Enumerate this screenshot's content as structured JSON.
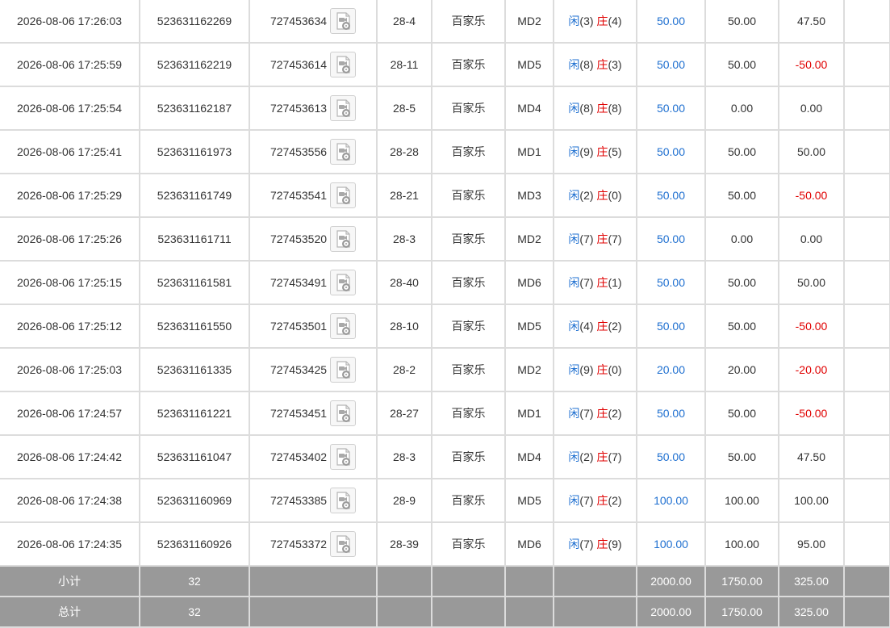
{
  "colors": {
    "player": "#1e6fd0",
    "banker": "#e00000",
    "negative": "#e00000",
    "summary_bg": "#999999"
  },
  "icons": {
    "replay": "video-replay-icon"
  },
  "rows": [
    {
      "time": "2026-08-06 17:26:03",
      "bet_id": "523631162269",
      "round_id": "727453634",
      "shoe": "28-4",
      "game": "百家乐",
      "table": "MD2",
      "player_label": "闲",
      "player_score": "(3)",
      "banker_label": "庄",
      "banker_score": "(4)",
      "bet": "50.00",
      "valid": "50.00",
      "payout": "47.50",
      "payout_negative": false
    },
    {
      "time": "2026-08-06 17:25:59",
      "bet_id": "523631162219",
      "round_id": "727453614",
      "shoe": "28-11",
      "game": "百家乐",
      "table": "MD5",
      "player_label": "闲",
      "player_score": "(8)",
      "banker_label": "庄",
      "banker_score": "(3)",
      "bet": "50.00",
      "valid": "50.00",
      "payout": "-50.00",
      "payout_negative": true
    },
    {
      "time": "2026-08-06 17:25:54",
      "bet_id": "523631162187",
      "round_id": "727453613",
      "shoe": "28-5",
      "game": "百家乐",
      "table": "MD4",
      "player_label": "闲",
      "player_score": "(8)",
      "banker_label": "庄",
      "banker_score": "(8)",
      "bet": "50.00",
      "valid": "0.00",
      "payout": "0.00",
      "payout_negative": false
    },
    {
      "time": "2026-08-06 17:25:41",
      "bet_id": "523631161973",
      "round_id": "727453556",
      "shoe": "28-28",
      "game": "百家乐",
      "table": "MD1",
      "player_label": "闲",
      "player_score": "(9)",
      "banker_label": "庄",
      "banker_score": "(5)",
      "bet": "50.00",
      "valid": "50.00",
      "payout": "50.00",
      "payout_negative": false
    },
    {
      "time": "2026-08-06 17:25:29",
      "bet_id": "523631161749",
      "round_id": "727453541",
      "shoe": "28-21",
      "game": "百家乐",
      "table": "MD3",
      "player_label": "闲",
      "player_score": "(2)",
      "banker_label": "庄",
      "banker_score": "(0)",
      "bet": "50.00",
      "valid": "50.00",
      "payout": "-50.00",
      "payout_negative": true
    },
    {
      "time": "2026-08-06 17:25:26",
      "bet_id": "523631161711",
      "round_id": "727453520",
      "shoe": "28-3",
      "game": "百家乐",
      "table": "MD2",
      "player_label": "闲",
      "player_score": "(7)",
      "banker_label": "庄",
      "banker_score": "(7)",
      "bet": "50.00",
      "valid": "0.00",
      "payout": "0.00",
      "payout_negative": false
    },
    {
      "time": "2026-08-06 17:25:15",
      "bet_id": "523631161581",
      "round_id": "727453491",
      "shoe": "28-40",
      "game": "百家乐",
      "table": "MD6",
      "player_label": "闲",
      "player_score": "(7)",
      "banker_label": "庄",
      "banker_score": "(1)",
      "bet": "50.00",
      "valid": "50.00",
      "payout": "50.00",
      "payout_negative": false
    },
    {
      "time": "2026-08-06 17:25:12",
      "bet_id": "523631161550",
      "round_id": "727453501",
      "shoe": "28-10",
      "game": "百家乐",
      "table": "MD5",
      "player_label": "闲",
      "player_score": "(4)",
      "banker_label": "庄",
      "banker_score": "(2)",
      "bet": "50.00",
      "valid": "50.00",
      "payout": "-50.00",
      "payout_negative": true
    },
    {
      "time": "2026-08-06 17:25:03",
      "bet_id": "523631161335",
      "round_id": "727453425",
      "shoe": "28-2",
      "game": "百家乐",
      "table": "MD2",
      "player_label": "闲",
      "player_score": "(9)",
      "banker_label": "庄",
      "banker_score": "(0)",
      "bet": "20.00",
      "valid": "20.00",
      "payout": "-20.00",
      "payout_negative": true
    },
    {
      "time": "2026-08-06 17:24:57",
      "bet_id": "523631161221",
      "round_id": "727453451",
      "shoe": "28-27",
      "game": "百家乐",
      "table": "MD1",
      "player_label": "闲",
      "player_score": "(7)",
      "banker_label": "庄",
      "banker_score": "(2)",
      "bet": "50.00",
      "valid": "50.00",
      "payout": "-50.00",
      "payout_negative": true
    },
    {
      "time": "2026-08-06 17:24:42",
      "bet_id": "523631161047",
      "round_id": "727453402",
      "shoe": "28-3",
      "game": "百家乐",
      "table": "MD4",
      "player_label": "闲",
      "player_score": "(2)",
      "banker_label": "庄",
      "banker_score": "(7)",
      "bet": "50.00",
      "valid": "50.00",
      "payout": "47.50",
      "payout_negative": false
    },
    {
      "time": "2026-08-06 17:24:38",
      "bet_id": "523631160969",
      "round_id": "727453385",
      "shoe": "28-9",
      "game": "百家乐",
      "table": "MD5",
      "player_label": "闲",
      "player_score": "(7)",
      "banker_label": "庄",
      "banker_score": "(2)",
      "bet": "100.00",
      "valid": "100.00",
      "payout": "100.00",
      "payout_negative": false
    },
    {
      "time": "2026-08-06 17:24:35",
      "bet_id": "523631160926",
      "round_id": "727453372",
      "shoe": "28-39",
      "game": "百家乐",
      "table": "MD6",
      "player_label": "闲",
      "player_score": "(7)",
      "banker_label": "庄",
      "banker_score": "(9)",
      "bet": "100.00",
      "valid": "100.00",
      "payout": "95.00",
      "payout_negative": false
    }
  ],
  "subtotal": {
    "label": "小计",
    "count": "32",
    "bet": "2000.00",
    "valid": "1750.00",
    "payout": "325.00"
  },
  "total": {
    "label": "总计",
    "count": "32",
    "bet": "2000.00",
    "valid": "1750.00",
    "payout": "325.00"
  }
}
